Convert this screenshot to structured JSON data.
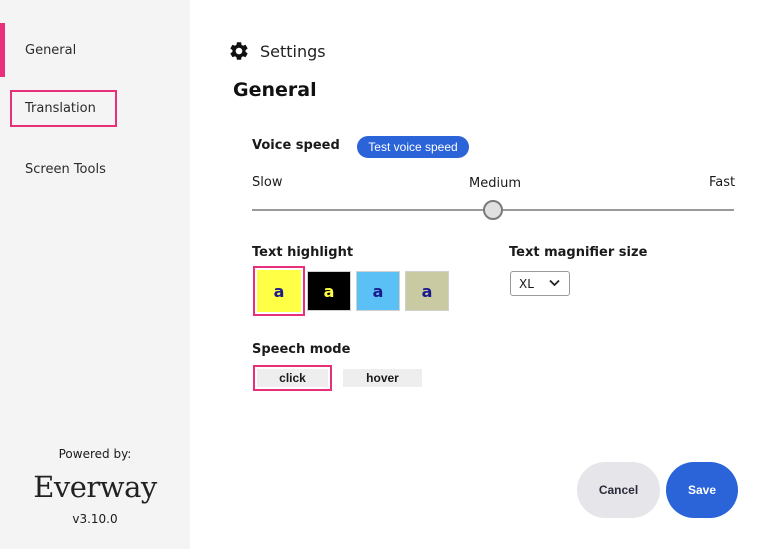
{
  "sidebar": {
    "items": [
      {
        "label": "General",
        "active": true
      },
      {
        "label": "Translation",
        "focused": true
      },
      {
        "label": "Screen Tools"
      }
    ],
    "powered_by": "Powered by:",
    "brand": "Everway",
    "version": "v3.10.0"
  },
  "header": {
    "icon": "gear-icon",
    "title": "Settings"
  },
  "page_title": "General",
  "voice_speed": {
    "label": "Voice speed",
    "test_button": "Test voice speed",
    "slow": "Slow",
    "medium": "Medium",
    "fast": "Fast",
    "level": 0.5
  },
  "text_highlight": {
    "label": "Text highlight",
    "glyph": "a",
    "swatches": [
      {
        "bg": "#ffff45",
        "fg": "#1a1a8c",
        "selected": true
      },
      {
        "bg": "#000000",
        "fg": "#ffff45"
      },
      {
        "bg": "#5bc0f5",
        "fg": "#1a1a8c"
      },
      {
        "bg": "#c9c9a2",
        "fg": "#1a1a8c"
      }
    ]
  },
  "magnifier": {
    "label": "Text magnifier size",
    "value": "XL"
  },
  "speech_mode": {
    "label": "Speech mode",
    "click": "click",
    "hover": "hover",
    "selected": "click"
  },
  "actions": {
    "cancel": "Cancel",
    "save": "Save"
  },
  "colors": {
    "accent": "#e8307a",
    "primary": "#2b63d9"
  }
}
